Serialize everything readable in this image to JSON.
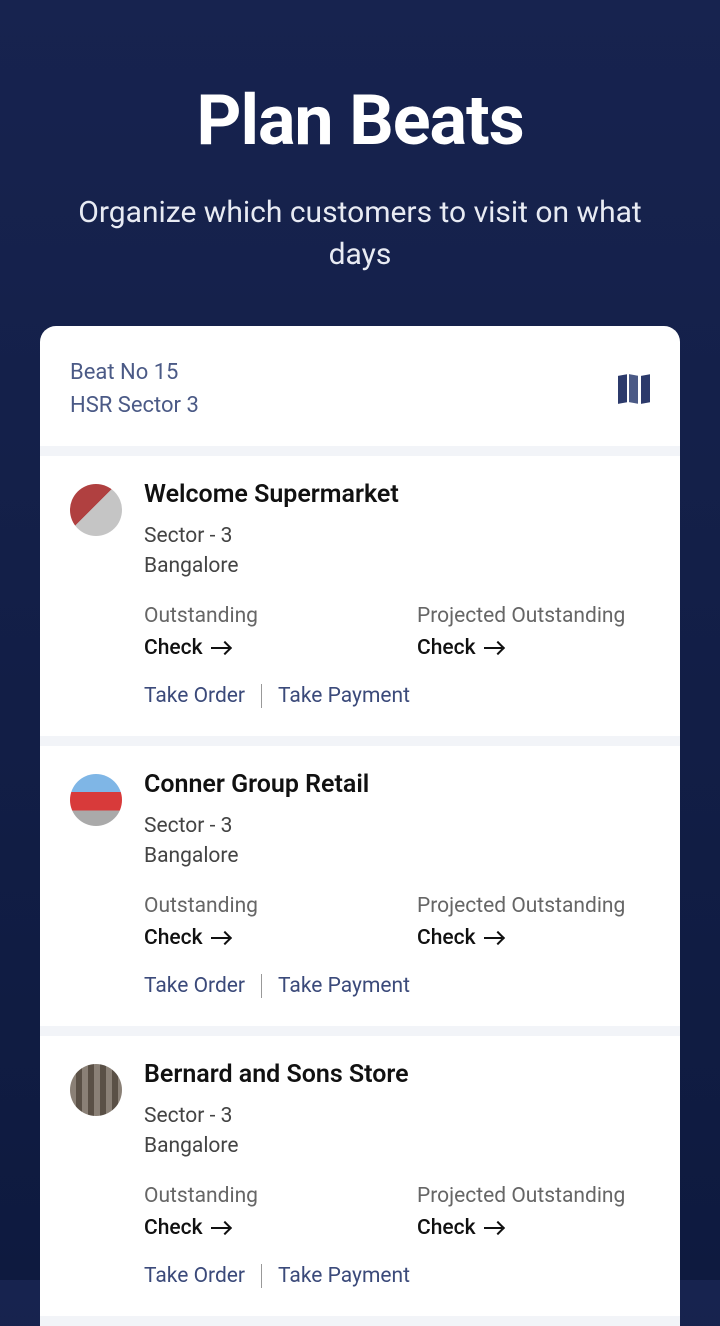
{
  "hero": {
    "title": "Plan Beats",
    "subtitle": "Organize which customers to visit on what days"
  },
  "header": {
    "beat_number": "Beat No 15",
    "beat_area": "HSR Sector 3"
  },
  "labels": {
    "outstanding": "Outstanding",
    "projected": "Projected Outstanding",
    "check": "Check",
    "take_order": "Take Order",
    "take_payment": "Take Payment"
  },
  "items": [
    {
      "name": "Welcome Supermarket",
      "sector": "Sector - 3",
      "city": "Bangalore",
      "avatar": ""
    },
    {
      "name": "Conner Group Retail",
      "sector": "Sector - 3",
      "city": "Bangalore",
      "avatar": "v2"
    },
    {
      "name": "Bernard and Sons Store",
      "sector": "Sector - 3",
      "city": "Bangalore",
      "avatar": "v3"
    }
  ]
}
